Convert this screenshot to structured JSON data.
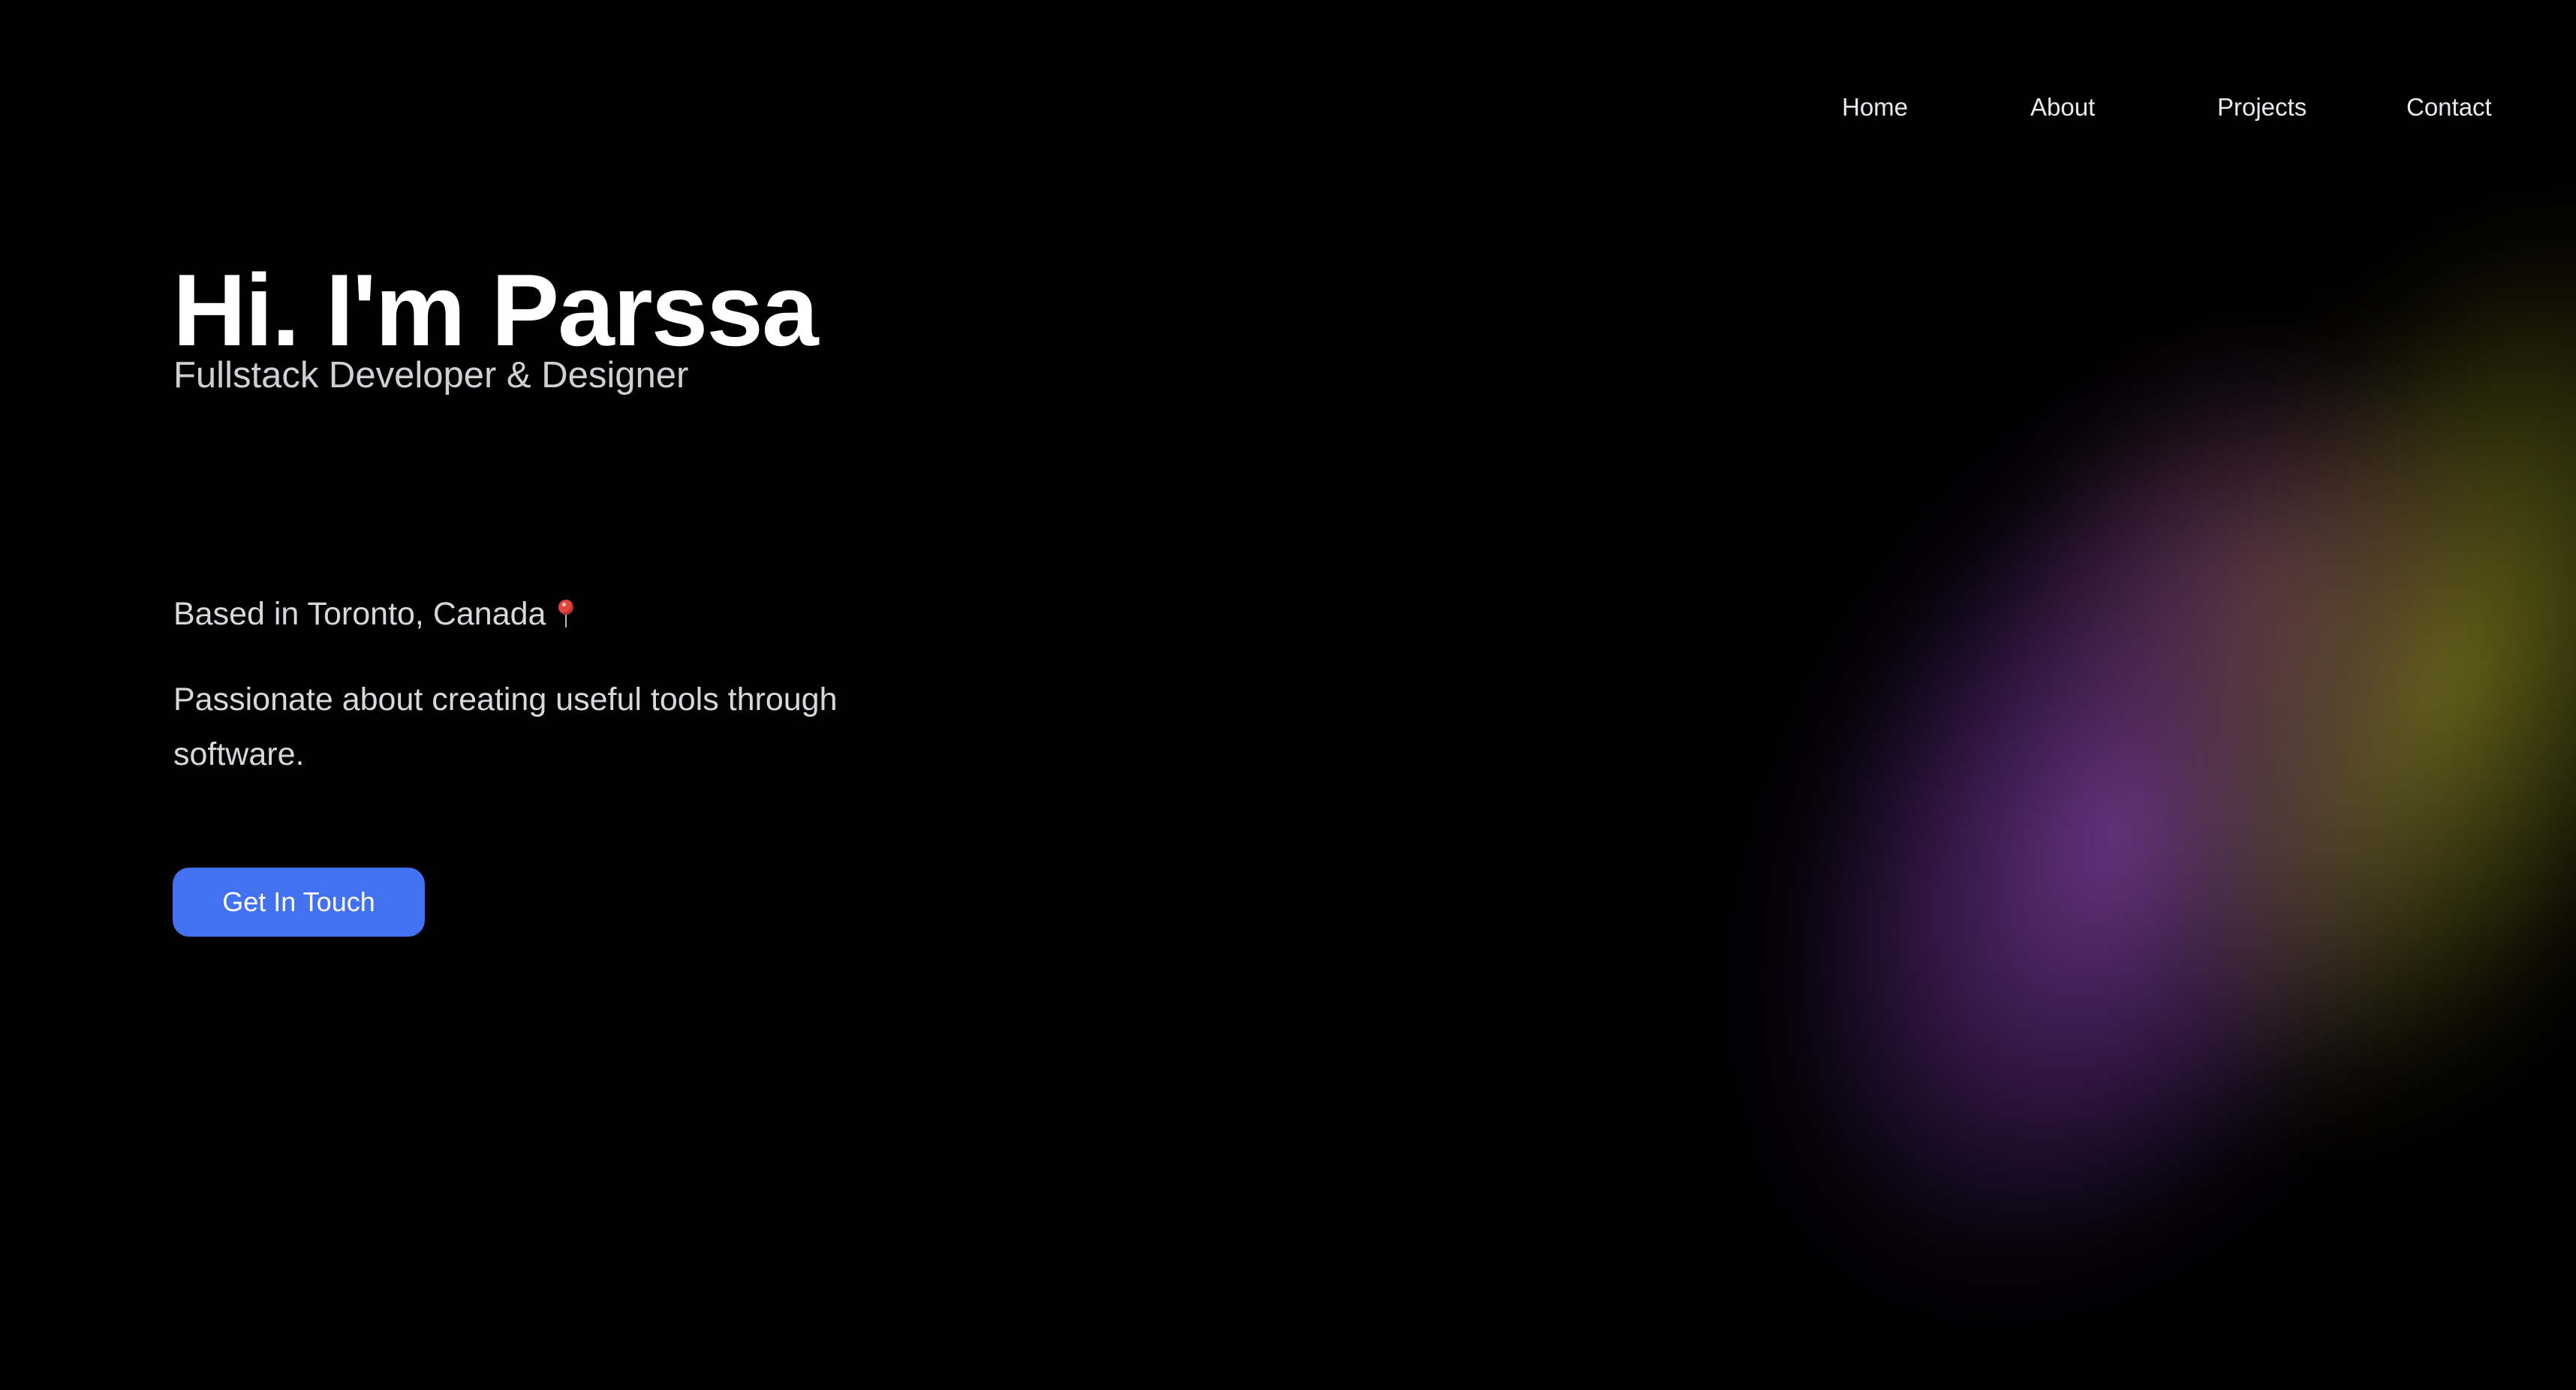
{
  "nav": {
    "items": [
      {
        "label": "Home"
      },
      {
        "label": "About"
      },
      {
        "label": "Projects"
      },
      {
        "label": "Contact"
      }
    ]
  },
  "hero": {
    "title": "Hi. I'm Parssa",
    "subtitle": "Fullstack Developer & Designer",
    "location": "Based in Toronto, Canada",
    "location_icon": "round-pushpin-icon",
    "tagline": "Passionate about creating useful tools through software.",
    "cta_label": "Get In Touch"
  },
  "colors": {
    "background": "#000000",
    "accent": "#4272f1",
    "glow_purple": "#8c46af",
    "glow_olive": "#8c8c1e"
  }
}
